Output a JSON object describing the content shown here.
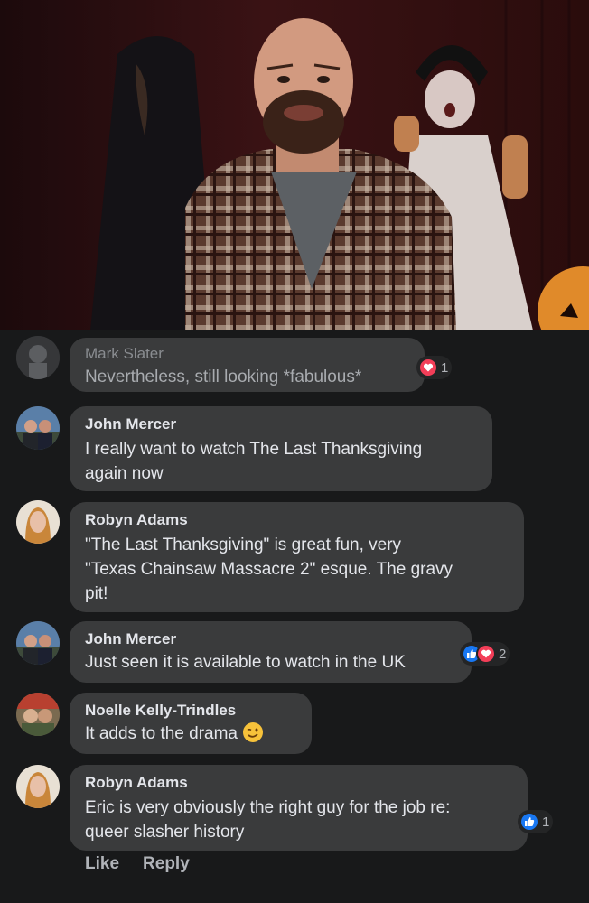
{
  "comments": [
    {
      "author": "Mark Slater",
      "text": "Nevertheless, still looking *fabulous*",
      "reactions": [
        "heart"
      ],
      "reaction_count": "1"
    },
    {
      "author": "John Mercer",
      "text_lines": [
        "I really want to watch The Last Thanksgiving",
        "again now"
      ]
    },
    {
      "author": "Robyn Adams",
      "text_lines": [
        "\"The Last Thanksgiving\" is great fun, very",
        "\"Texas Chainsaw Massacre 2\" esque. The gravy",
        "pit!"
      ]
    },
    {
      "author": "John Mercer",
      "text": "Just seen it is available to watch in the UK",
      "reactions": [
        "like",
        "heart"
      ],
      "reaction_count": "2"
    },
    {
      "author": "Noelle Kelly-Trindles",
      "text": "It adds to the drama",
      "emoji": "winking-face"
    },
    {
      "author": "Robyn Adams",
      "text_lines": [
        "Eric is very obviously the right guy for the job re:",
        "queer slasher history"
      ],
      "reactions": [
        "like"
      ],
      "reaction_count": "1"
    }
  ],
  "actions": {
    "like_label": "Like",
    "reply_label": "Reply"
  },
  "colors": {
    "background": "#18191a",
    "bubble": "#3a3b3c",
    "like_blue": "#1877f2",
    "heart_red": "#f33e58"
  }
}
